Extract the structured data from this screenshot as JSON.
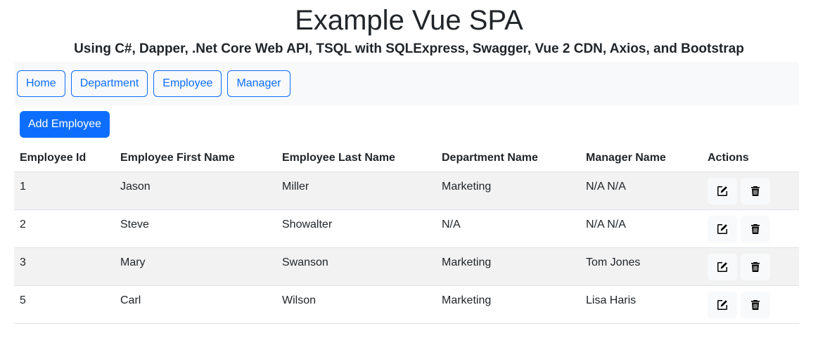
{
  "header": {
    "title": "Example Vue SPA",
    "subtitle": "Using C#, Dapper, .Net Core Web API, TSQL with SQLExpress, Swagger, Vue 2 CDN, Axios, and Bootstrap"
  },
  "nav": {
    "items": [
      {
        "label": "Home"
      },
      {
        "label": "Department"
      },
      {
        "label": "Employee"
      },
      {
        "label": "Manager"
      }
    ]
  },
  "toolbar": {
    "add_label": "Add Employee"
  },
  "table": {
    "columns": [
      "Employee Id",
      "Employee First Name",
      "Employee Last Name",
      "Department Name",
      "Manager Name",
      "Actions"
    ],
    "rows": [
      {
        "id": "1",
        "first": "Jason",
        "last": "Miller",
        "department": "Marketing",
        "manager": "N/A N/A"
      },
      {
        "id": "2",
        "first": "Steve",
        "last": "Showalter",
        "department": "N/A",
        "manager": "N/A N/A"
      },
      {
        "id": "3",
        "first": "Mary",
        "last": "Swanson",
        "department": "Marketing",
        "manager": "Tom Jones"
      },
      {
        "id": "5",
        "first": "Carl",
        "last": "Wilson",
        "department": "Marketing",
        "manager": "Lisa Haris"
      }
    ]
  },
  "icons": {
    "edit": "edit-icon",
    "delete": "trash-icon"
  },
  "colors": {
    "primary": "#0d6efd",
    "stripe": "#f2f2f2",
    "nav_bg": "#f8f9fa"
  }
}
